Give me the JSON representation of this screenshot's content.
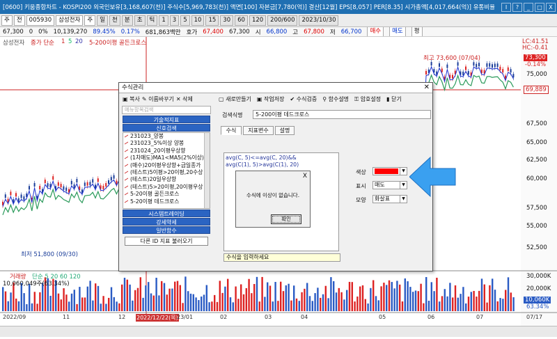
{
  "titlebar": {
    "text": "[0600] 키움종합차트 - KOSPI200 외국인보유[3,168,607(천)] 주식수[5,969,783(천)] 액면[100] 자본금[7,780(억)] 결산[12월] EPS[8,057] PER[8.35] 시가총액[4,017,664(억)] 유통비율",
    "buttons": [
      "I",
      "?",
      "_",
      "□",
      "X"
    ]
  },
  "toolbar": {
    "items": [
      "주",
      "전",
      "005930",
      "삼성전자",
      "주",
      "일",
      "천",
      "분",
      "초",
      "틱",
      "1",
      "3",
      "5",
      "10",
      "15",
      "30",
      "60",
      "120",
      "200/600",
      "2023/10/30"
    ]
  },
  "quote": {
    "price": "67,300",
    "change": "0",
    "pct": "0%",
    "volume": "10,139,270",
    "ratio": "89.45%",
    "rate": "0.17%",
    "amount": "681,863백만",
    "ask_label": "호가",
    "ask": "67,400",
    "bid": "67,300",
    "open_label": "시",
    "open": "66,800",
    "high_label": "고",
    "high": "67,800",
    "low_label": "저",
    "low": "66,700",
    "buy": "매수",
    "sell": "매도",
    "flat": "평"
  },
  "chart": {
    "stock": "삼성전자",
    "ma_label": "종가 단순",
    "ma1": "1",
    "ma5": "5",
    "ma20": "20",
    "signal": "5-200이평 골든크로스",
    "high_label": "최고 73,600 (07/04)",
    "low_label": "최저 51,800 (09/30)",
    "price_tag": "73,300",
    "pct_tag": "-0.14%",
    "lc": "LC:41.51",
    "hc": "HC:-0.41",
    "hline": "69,889",
    "vol_label": "거래량",
    "vol_ma": "단순 5 20 60 120",
    "vol_value": "10,060,049주(63.34%)",
    "vol_tag": "10,060K",
    "vol_pct": "63.34%",
    "price_axis": [
      "75,000",
      "67,500",
      "65,000",
      "62,500",
      "60,000",
      "57,500",
      "55,000",
      "52,500"
    ],
    "vol_axis": [
      "30,000K",
      "20,000K"
    ],
    "dates": [
      "2022/09",
      "11",
      "12",
      "2022/12/22(목)",
      "23/01",
      "02",
      "03",
      "04",
      "05",
      "06",
      "07"
    ],
    "end_date": "07/17"
  },
  "dialog": {
    "title": "수식관리",
    "tb_left": [
      "복사",
      "이름바꾸기",
      "삭제"
    ],
    "tb_right": [
      "새로만들기",
      "작업저장",
      "수식검증",
      "함수설명",
      "암호설정",
      "닫기"
    ],
    "search_placeholder": "메뉴항목검색",
    "cat1": "기술적지표",
    "cat2": "신호검색",
    "items": [
      "231023_양봉",
      "231023_5%이상 양봉",
      "231024_20이평우상향",
      "(1차매도)MA1<MA5(2%이상)",
      "(매수)20이평우상향+급일종가",
      "(테스트)5이평>20이평,20수상",
      "(테스트)20일우상향",
      "(테스트)5>20이평,20이평우상",
      "5-20이평 골든크로스",
      "5-20이평 데드크로스"
    ],
    "cat3": "시스템트레이딩",
    "cat4": "강세약세",
    "cat5": "일반함수",
    "load_btn": "다른 ID 지표 불러오기",
    "name_label": "검색식명",
    "name_value": "5-200이평 데드크로스",
    "tabs": [
      "수식",
      "지표변수",
      "설명"
    ],
    "code1": "avg(C, 5)<=avg(C, 20)&&",
    "code2": "avg(C(1), 5)>avg(C(1), 20)",
    "hint": "수식을 입력하세요",
    "color_label": "색상",
    "mark_label": "표시",
    "mark_value": "매도",
    "shape_label": "모양",
    "shape_value": "화살표",
    "color_value": "#ff0000"
  },
  "msgbox": {
    "close": "X",
    "text": "수식에 이상이 없습니다.",
    "ok": "확인"
  }
}
